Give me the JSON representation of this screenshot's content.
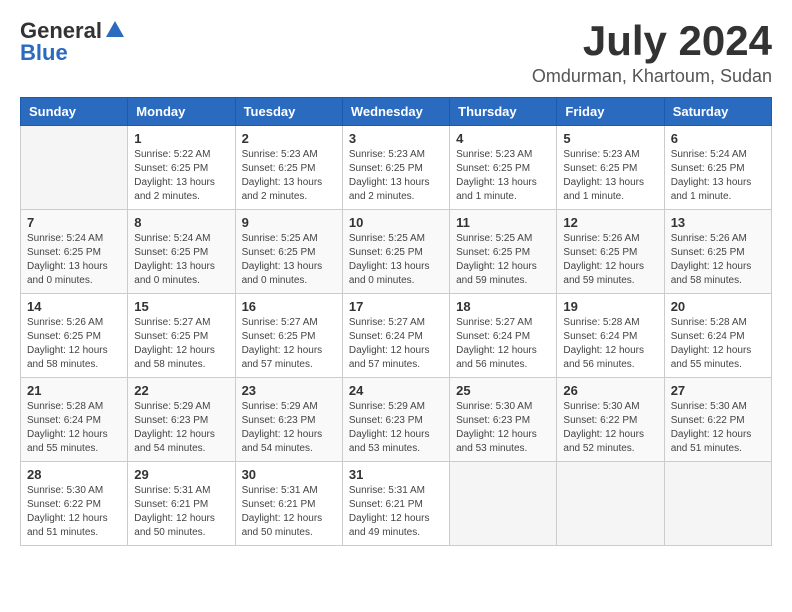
{
  "header": {
    "logo_general": "General",
    "logo_blue": "Blue",
    "title": "July 2024",
    "subtitle": "Omdurman, Khartoum, Sudan"
  },
  "days_of_week": [
    "Sunday",
    "Monday",
    "Tuesday",
    "Wednesday",
    "Thursday",
    "Friday",
    "Saturday"
  ],
  "weeks": [
    [
      {
        "day": "",
        "info": ""
      },
      {
        "day": "1",
        "info": "Sunrise: 5:22 AM\nSunset: 6:25 PM\nDaylight: 13 hours\nand 2 minutes."
      },
      {
        "day": "2",
        "info": "Sunrise: 5:23 AM\nSunset: 6:25 PM\nDaylight: 13 hours\nand 2 minutes."
      },
      {
        "day": "3",
        "info": "Sunrise: 5:23 AM\nSunset: 6:25 PM\nDaylight: 13 hours\nand 2 minutes."
      },
      {
        "day": "4",
        "info": "Sunrise: 5:23 AM\nSunset: 6:25 PM\nDaylight: 13 hours\nand 1 minute."
      },
      {
        "day": "5",
        "info": "Sunrise: 5:23 AM\nSunset: 6:25 PM\nDaylight: 13 hours\nand 1 minute."
      },
      {
        "day": "6",
        "info": "Sunrise: 5:24 AM\nSunset: 6:25 PM\nDaylight: 13 hours\nand 1 minute."
      }
    ],
    [
      {
        "day": "7",
        "info": "Sunrise: 5:24 AM\nSunset: 6:25 PM\nDaylight: 13 hours\nand 0 minutes."
      },
      {
        "day": "8",
        "info": "Sunrise: 5:24 AM\nSunset: 6:25 PM\nDaylight: 13 hours\nand 0 minutes."
      },
      {
        "day": "9",
        "info": "Sunrise: 5:25 AM\nSunset: 6:25 PM\nDaylight: 13 hours\nand 0 minutes."
      },
      {
        "day": "10",
        "info": "Sunrise: 5:25 AM\nSunset: 6:25 PM\nDaylight: 13 hours\nand 0 minutes."
      },
      {
        "day": "11",
        "info": "Sunrise: 5:25 AM\nSunset: 6:25 PM\nDaylight: 12 hours\nand 59 minutes."
      },
      {
        "day": "12",
        "info": "Sunrise: 5:26 AM\nSunset: 6:25 PM\nDaylight: 12 hours\nand 59 minutes."
      },
      {
        "day": "13",
        "info": "Sunrise: 5:26 AM\nSunset: 6:25 PM\nDaylight: 12 hours\nand 58 minutes."
      }
    ],
    [
      {
        "day": "14",
        "info": "Sunrise: 5:26 AM\nSunset: 6:25 PM\nDaylight: 12 hours\nand 58 minutes."
      },
      {
        "day": "15",
        "info": "Sunrise: 5:27 AM\nSunset: 6:25 PM\nDaylight: 12 hours\nand 58 minutes."
      },
      {
        "day": "16",
        "info": "Sunrise: 5:27 AM\nSunset: 6:25 PM\nDaylight: 12 hours\nand 57 minutes."
      },
      {
        "day": "17",
        "info": "Sunrise: 5:27 AM\nSunset: 6:24 PM\nDaylight: 12 hours\nand 57 minutes."
      },
      {
        "day": "18",
        "info": "Sunrise: 5:27 AM\nSunset: 6:24 PM\nDaylight: 12 hours\nand 56 minutes."
      },
      {
        "day": "19",
        "info": "Sunrise: 5:28 AM\nSunset: 6:24 PM\nDaylight: 12 hours\nand 56 minutes."
      },
      {
        "day": "20",
        "info": "Sunrise: 5:28 AM\nSunset: 6:24 PM\nDaylight: 12 hours\nand 55 minutes."
      }
    ],
    [
      {
        "day": "21",
        "info": "Sunrise: 5:28 AM\nSunset: 6:24 PM\nDaylight: 12 hours\nand 55 minutes."
      },
      {
        "day": "22",
        "info": "Sunrise: 5:29 AM\nSunset: 6:23 PM\nDaylight: 12 hours\nand 54 minutes."
      },
      {
        "day": "23",
        "info": "Sunrise: 5:29 AM\nSunset: 6:23 PM\nDaylight: 12 hours\nand 54 minutes."
      },
      {
        "day": "24",
        "info": "Sunrise: 5:29 AM\nSunset: 6:23 PM\nDaylight: 12 hours\nand 53 minutes."
      },
      {
        "day": "25",
        "info": "Sunrise: 5:30 AM\nSunset: 6:23 PM\nDaylight: 12 hours\nand 53 minutes."
      },
      {
        "day": "26",
        "info": "Sunrise: 5:30 AM\nSunset: 6:22 PM\nDaylight: 12 hours\nand 52 minutes."
      },
      {
        "day": "27",
        "info": "Sunrise: 5:30 AM\nSunset: 6:22 PM\nDaylight: 12 hours\nand 51 minutes."
      }
    ],
    [
      {
        "day": "28",
        "info": "Sunrise: 5:30 AM\nSunset: 6:22 PM\nDaylight: 12 hours\nand 51 minutes."
      },
      {
        "day": "29",
        "info": "Sunrise: 5:31 AM\nSunset: 6:21 PM\nDaylight: 12 hours\nand 50 minutes."
      },
      {
        "day": "30",
        "info": "Sunrise: 5:31 AM\nSunset: 6:21 PM\nDaylight: 12 hours\nand 50 minutes."
      },
      {
        "day": "31",
        "info": "Sunrise: 5:31 AM\nSunset: 6:21 PM\nDaylight: 12 hours\nand 49 minutes."
      },
      {
        "day": "",
        "info": ""
      },
      {
        "day": "",
        "info": ""
      },
      {
        "day": "",
        "info": ""
      }
    ]
  ]
}
